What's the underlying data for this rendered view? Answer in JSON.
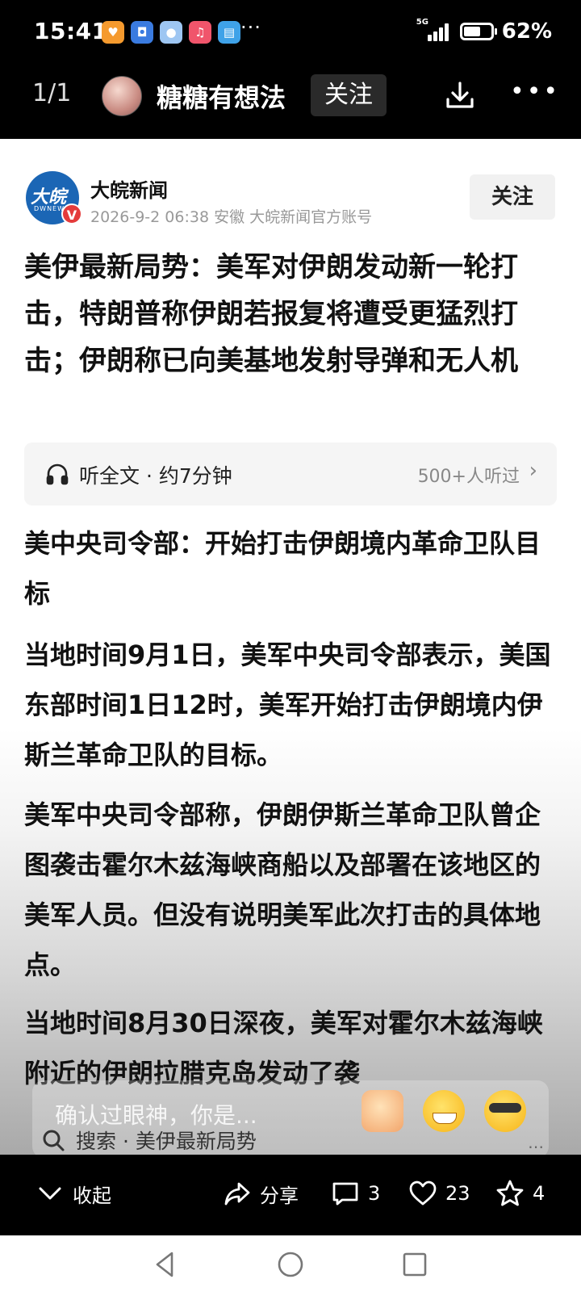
{
  "status_bar": {
    "time": "15:41",
    "more_indicator": "···",
    "network": "5G",
    "battery_text": "62%",
    "battery_level": 0.62
  },
  "app_header": {
    "page_indicator": "1/1",
    "author_name": "糖糖有想法",
    "follow_label": "关注",
    "icons": [
      "download-icon",
      "more-icon"
    ]
  },
  "source": {
    "logo_text": "大皖",
    "logo_subtext": "DWNEWS",
    "verified_badge": "V",
    "name": "大皖新闻",
    "meta": "2026-9-2  06:38  安徽  大皖新闻官方账号",
    "follow_label": "关注"
  },
  "article": {
    "title": "美伊最新局势：美军对伊朗发动新一轮打击，特朗普称伊朗若报复将遭受更猛烈打击；伊朗称已向美基地发射导弹和无人机",
    "listen": {
      "label": "听全文 · 约7分钟",
      "count": "500+人听过",
      "chevron": "›"
    },
    "paragraphs": [
      "美中央司令部：开始打击伊朗境内革命卫队目标",
      "当地时间9月1日，美军中央司令部表示，美国东部时间1日12时，美军开始打击伊朗境内伊斯兰革命卫队的目标。",
      "美军中央司令部称，伊朗伊斯兰革命卫队曾企图袭击霍尔木兹海峡商船以及部署在该地区的美军人员。但没有说明美军此次打击的具体地点。",
      "当地时间8月30日深夜，美军对霍尔木兹海峡附近的伊朗拉腊克岛发动了袭"
    ]
  },
  "overlay": {
    "comment_preview": "确认过眼神，你是...",
    "emojis": [
      "thumbs-up-emoji",
      "grin-emoji",
      "cool-emoji"
    ],
    "search_text": "搜索 · 美伊最新局势"
  },
  "action_bar": {
    "collapse_label": "收起",
    "share_label": "分享",
    "comments_count": "3",
    "likes_count": "23",
    "favorites_count": "4"
  },
  "nav_bar": {
    "buttons": [
      "back-icon",
      "home-icon",
      "recents-icon"
    ]
  }
}
